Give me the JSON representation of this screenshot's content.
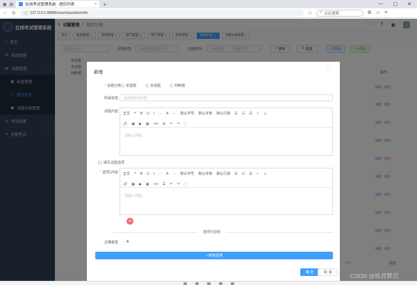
{
  "browser": {
    "tab_title": "在线考试管理系统 - 题目列表",
    "url": "127.0.0.1:8888/exam/questioninfo",
    "search_placeholder": "点此搜索"
  },
  "sidebar": {
    "brand": "在线考试管理系统",
    "items": [
      {
        "label": "首页"
      },
      {
        "label": "系统管理"
      },
      {
        "label": "试题管理"
      },
      {
        "label": "标签管理"
      },
      {
        "label": "题目列表"
      },
      {
        "label": "试题分类管理"
      },
      {
        "label": "考试设置"
      },
      {
        "label": "答题考试"
      }
    ]
  },
  "topbar": {
    "crumb_a": "试题管理",
    "sep": "/",
    "crumb_b": "题目列表"
  },
  "tags": [
    "首页",
    "角色管理",
    "菜单管理",
    "部门管理",
    "用户管理",
    "标签管理",
    "题目列表",
    "试题分类管理"
  ],
  "filter": {
    "input1": "请输入名称",
    "label2": "试题标签",
    "input2": "请选择标签后分类",
    "label3": "创建时间",
    "input3a": "开始日期",
    "input3b": "结束日期",
    "search": "搜索",
    "reset": "重置",
    "add": "+ 新增",
    "edit": "✎ 修改"
  },
  "list": {
    "side_labels": [
      "单选题",
      "多选题",
      "判断题"
    ],
    "ops_header": "操作",
    "edit": "编辑",
    "del": "删除",
    "pager_size": "8条/页",
    "pager_nav": "‹ 1 ›",
    "pager_goto": "前往"
  },
  "dialog": {
    "title": "新增",
    "category_label": "试题分类",
    "radios": [
      "单选题",
      "多选题",
      "判断题"
    ],
    "tag_label": "所属标签",
    "tag_placeholder": "请选择所属标签",
    "content_label": "试题内容",
    "toolbar_row1": [
      "正文",
      "❝",
      "B",
      "U",
      "I",
      "···",
      "A",
      "···",
      "默认字号",
      "默认字体",
      "默认行高",
      "☰",
      "☷",
      "☰",
      "✓",
      "☺"
    ],
    "toolbar_row2": [
      "🔗",
      "▣",
      "▶",
      "▦",
      "</>",
      "☰",
      "↶",
      "↷",
      "⛶"
    ],
    "editor_placeholder": "请输入内容...",
    "checkbox_label": "填写试题选项",
    "option_label": "选项1内容",
    "option_placeholder": "请输入内容...",
    "delete_symbol": "⊖",
    "divider_text": "选项分割线",
    "answer_label": "正确答案",
    "answer_value": "A",
    "add_option": "+ 新增选项",
    "ok": "确 定",
    "cancel": "取 消"
  },
  "watermark": "CSDN @玖月梦沉"
}
